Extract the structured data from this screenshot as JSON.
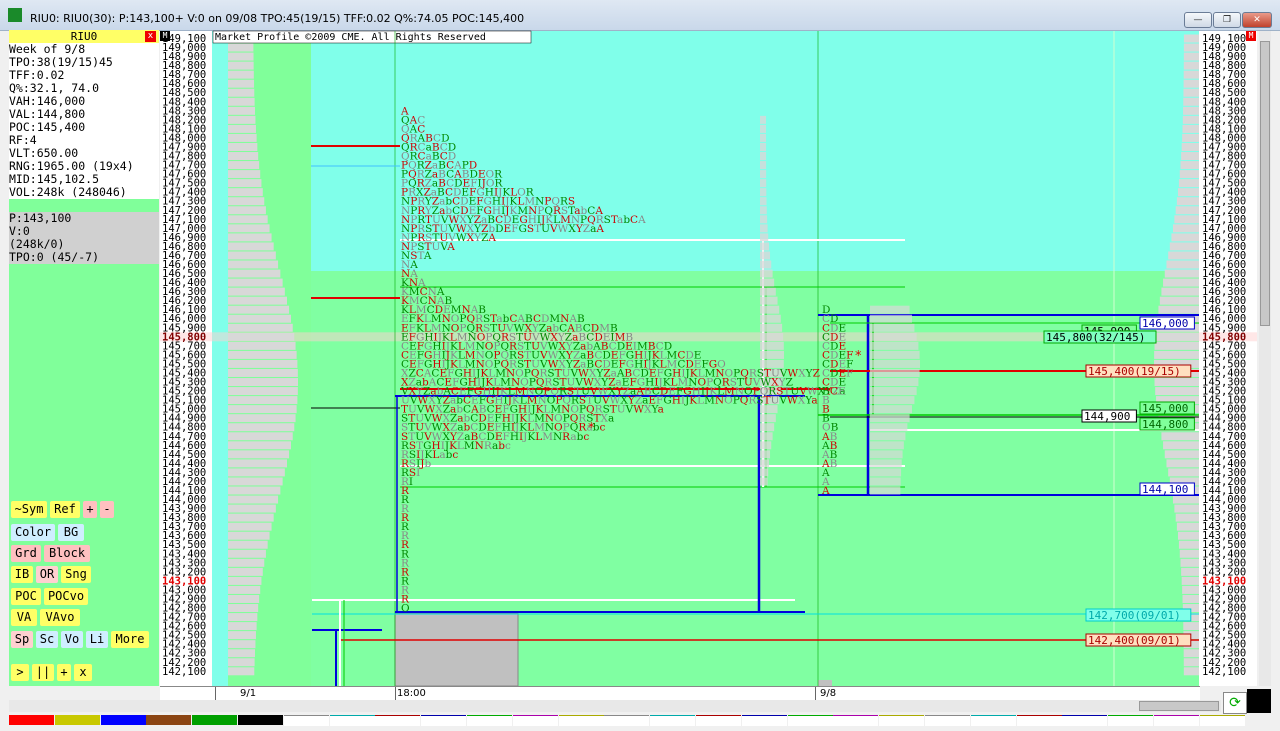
{
  "window": {
    "title": "RIU0: RIU0(30): P:143,100+ V:0 on 09/08 TPO:45(19/15) TFF:0.02 Q%:74.05 POC:145,400",
    "min_label": "—",
    "max_label": "❐",
    "close_label": "✕"
  },
  "panel": {
    "symbol": "RIU0",
    "close_label": "x",
    "stats": [
      "Week of 9/8",
      "TPO:38(19/15)45",
      "TFF:0.02",
      "Q%:32.1, 74.0",
      "VAH:146,000",
      "VAL:144,800",
      "POC:145,400",
      "RF:4",
      "VLT:650.00",
      "RNG:1965.00 (19x4)",
      "MID:145,102.5",
      "VOL:248k (248046)",
      "",
      "P:143,100",
      "V:0",
      "(248k/0)",
      "TPO:0 (45/-7)"
    ],
    "buttons": [
      [
        "~Sym",
        "Ref",
        "+",
        "-"
      ],
      [
        "Color",
        "BG"
      ],
      [
        "Grd",
        "Block"
      ],
      [
        "IB",
        "OR",
        "Sng"
      ],
      [
        "POC",
        "POCvo"
      ],
      [
        "VA",
        "VAvo"
      ],
      [
        "Sp",
        "Sc",
        "Vo",
        "Li",
        "More"
      ],
      [
        ">",
        "||",
        "+",
        "x"
      ]
    ]
  },
  "marker_left": "M",
  "marker_right": "M",
  "chart_data": {
    "type": "market-profile",
    "title": "Market Profile ©2009 CME. All Rights Reserved",
    "y_ticks": [
      "149,100",
      "149,000",
      "148,900",
      "148,800",
      "148,700",
      "148,600",
      "148,500",
      "148,400",
      "148,300",
      "148,200",
      "148,100",
      "148,000",
      "147,900",
      "147,800",
      "147,700",
      "147,600",
      "147,500",
      "147,400",
      "147,300",
      "147,200",
      "147,100",
      "147,000",
      "146,900",
      "146,800",
      "146,700",
      "146,600",
      "146,500",
      "146,400",
      "146,300",
      "146,200",
      "146,100",
      "146,000",
      "145,900",
      "145,800",
      "145,700",
      "145,600",
      "145,500",
      "145,400",
      "145,300",
      "145,200",
      "145,100",
      "145,000",
      "144,900",
      "144,800",
      "144,700",
      "144,600",
      "144,500",
      "144,400",
      "144,300",
      "144,200",
      "144,100",
      "144,000",
      "143,900",
      "143,800",
      "143,700",
      "143,600",
      "143,500",
      "143,400",
      "143,300",
      "143,200",
      "143,100",
      "143,000",
      "142,900",
      "142,800",
      "142,700",
      "142,600",
      "142,500",
      "142,400",
      "142,300",
      "142,200",
      "142,100"
    ],
    "ylim": [
      142100,
      149100
    ],
    "last_price": 143100,
    "highlight_price": 145800,
    "x_labels": [
      "9/1",
      "18:00",
      "9/8"
    ],
    "profiles": [
      {
        "name": "9/1",
        "letters": [
          [
            148300,
            "A"
          ],
          [
            148200,
            "QAC"
          ],
          [
            148100,
            "QAC"
          ],
          [
            148000,
            "QRABCD"
          ],
          [
            147900,
            "QRCaBCD"
          ],
          [
            147800,
            "QRCaBCD"
          ],
          [
            147700,
            "PQRZaBCAPD"
          ],
          [
            147600,
            "PQRZaBCABDEOR"
          ],
          [
            147500,
            "PQRZaBCDEFIJOR"
          ],
          [
            147400,
            "PRXZaBCDEFGHIJKLOR"
          ],
          [
            147300,
            "NPRYZabCDEFGHIJKLMNPQRS"
          ],
          [
            147200,
            "NPRYZabCDEFGHIJKMNPQRSTabCA"
          ],
          [
            147100,
            "NPRTUVWXYZaBCDEGHIJKLMNPQRSTabCA"
          ],
          [
            147000,
            "NPRSTUVWXYZbDEFGSTUVWXYZaA"
          ],
          [
            146900,
            "NPRSTUVWXYZA"
          ],
          [
            146800,
            "NPSTUVA"
          ],
          [
            146700,
            "NSTA"
          ],
          [
            146600,
            "NA"
          ],
          [
            146500,
            "NA"
          ],
          [
            146400,
            "KNA"
          ],
          [
            146300,
            "KMCNA"
          ],
          [
            146200,
            "KMCNAB"
          ],
          [
            146100,
            "KLMCDEMNAB"
          ],
          [
            146000,
            "EFKLMNOPQRSTabCABCDMNAB"
          ],
          [
            145900,
            "EFKLMNOPQRSTUVWXYZabCABCDMB"
          ],
          [
            145800,
            "EFGHIJKLMNOPQRSTUVWXYZaBCDEIMB"
          ],
          [
            145700,
            "CEFGHIJKLMNOPQRSTUVWXYZabABCDEIMBCD"
          ],
          [
            145600,
            "CEFGHIJKLMNOPQRSTUVWXYZaBCDEFGHIJKLMCDE"
          ],
          [
            145500,
            "CEFGHIJKLMNOPQRSTUVWXYZaBCDEFGHIJKLMCDEFGO"
          ],
          [
            145400,
            "XZCACEFGHIJKLMNOPQRSTUVWXYZaABCDEFGHIJKLMNOPQRSTUVWXYZ"
          ],
          [
            145300,
            "XZabACEFGHIJKLMNOPQRSTUVWXYZaEFGHIJKLMNOPQRSTUVWXYZ"
          ],
          [
            145200,
            "VXYZabACEFGHIJKLMNOPQRSTUVWXYZaABCDEFGHIJKLMNOPQRSTUVWXYZa"
          ],
          [
            145100,
            "UVWXYZabCEFGHIJKLMNOPQRSTUVWXYZaEFGHIJKLMNOPQRSTUVWXYa"
          ],
          [
            145000,
            "TUVWXZabCABCEFGHIJKLMNOPQRSTUVWXYa"
          ],
          [
            144900,
            "STUVWXZabCDEFHIJKLMNOPQRSTXa"
          ],
          [
            144800,
            "STUVWXZabCDEFHIJKLMNOPQRabc"
          ],
          [
            144700,
            "STUVWXYZaBCDEFHIJKLMNRabc"
          ],
          [
            144600,
            "RSTGHIJKLMNRabc"
          ],
          [
            144500,
            "RSIJKLabc"
          ],
          [
            144400,
            "RSIJb"
          ],
          [
            144300,
            "RSI"
          ],
          [
            144200,
            "RI"
          ],
          [
            144100,
            "R"
          ],
          [
            144000,
            "R"
          ],
          [
            143900,
            "R"
          ],
          [
            143800,
            "R"
          ],
          [
            143700,
            "R"
          ],
          [
            143600,
            "R"
          ],
          [
            143500,
            "R"
          ],
          [
            143400,
            "R"
          ],
          [
            143300,
            "R"
          ],
          [
            143200,
            "R"
          ],
          [
            143100,
            "R"
          ],
          [
            143000,
            "R"
          ],
          [
            142900,
            "R"
          ],
          [
            142800,
            "O"
          ]
        ]
      },
      {
        "name": "9/8",
        "letters": [
          [
            146100,
            "D"
          ],
          [
            146000,
            "CD"
          ],
          [
            145900,
            "CDE"
          ],
          [
            145800,
            "CDE"
          ],
          [
            145700,
            "CDE"
          ],
          [
            145600,
            "CDEF"
          ],
          [
            145500,
            "CDEF"
          ],
          [
            145400,
            "CDEF"
          ],
          [
            145300,
            "CDE"
          ],
          [
            145200,
            "BCE"
          ],
          [
            145100,
            "B"
          ],
          [
            145000,
            "B"
          ],
          [
            144900,
            "B"
          ],
          [
            144800,
            "OB"
          ],
          [
            144700,
            "AB"
          ],
          [
            144600,
            "AB"
          ],
          [
            144500,
            "AB"
          ],
          [
            144400,
            "AB"
          ],
          [
            144300,
            "A"
          ],
          [
            144200,
            "A"
          ],
          [
            144100,
            "A"
          ]
        ]
      }
    ],
    "right_labels": [
      "146,000",
      "145,900",
      "145,800(32/145)",
      "145,400(19/15)",
      "145,000",
      "144,900",
      "144,800",
      "144,100",
      "142,700(09/01)",
      "142,400(09/01)"
    ]
  },
  "colors": {
    "chart_bg": "#80ffea",
    "profile_bg": "#80ff9a",
    "tick_red": "#e00000",
    "poc_line": "#e00000",
    "vah_line": "#00cc00",
    "blue_line": "#0000dd",
    "letter_green": "#008800",
    "letter_red": "#cc0000",
    "letter_gray": "#888888"
  },
  "date_bar": [
    "9/1",
    "18:00",
    "9/8"
  ],
  "color_strip": [
    "#ff0000",
    "#c8c800",
    "#0000ff",
    "#8b4513",
    "#00a000",
    "#000000",
    "#ffffff",
    "#ffffff",
    "#ffffff",
    "#ffffff",
    "#ffffff",
    "#ffffff",
    "#ffffff",
    "#ffffff",
    "#ffffff",
    "#ffffff",
    "#ffffff",
    "#ffffff",
    "#ffffff",
    "#ffffff",
    "#ffffff",
    "#ffffff",
    "#ffffff",
    "#ffffff",
    "#ffffff",
    "#ffffff",
    "#ffffff"
  ]
}
